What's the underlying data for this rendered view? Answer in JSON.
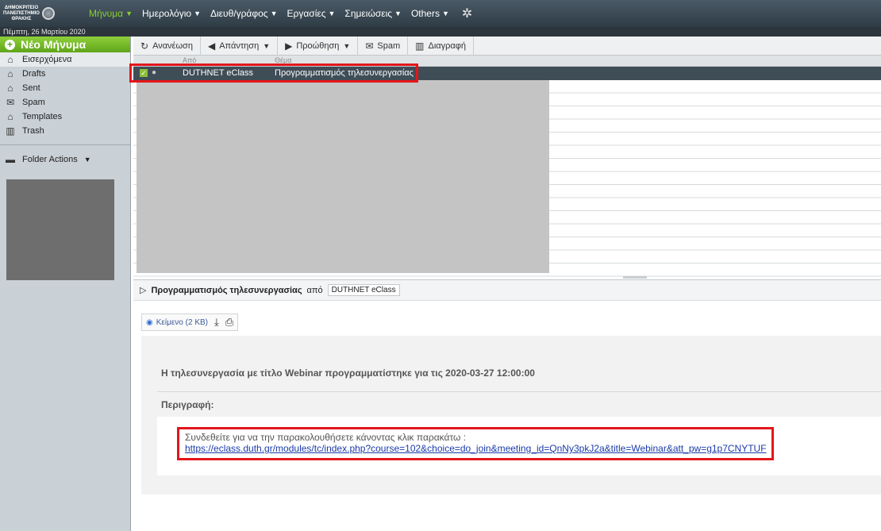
{
  "brand": {
    "logo_lines": [
      "ΔΗΜΟΚΡΙΤΕΙΟ",
      "ΠΑΝΕΠΙΣΤΗΜΙΟ",
      "ΘΡΑΚΗΣ"
    ]
  },
  "menu": [
    {
      "label": "Μήνυμα",
      "active": true
    },
    {
      "label": "Ημερολόγιο",
      "active": false
    },
    {
      "label": "Διευθ/γράφος",
      "active": false
    },
    {
      "label": "Εργασίες",
      "active": false
    },
    {
      "label": "Σημειώσεις",
      "active": false
    },
    {
      "label": "Others",
      "active": false
    }
  ],
  "date": "Πέμπτη, 26 Μαρτίου 2020",
  "sidebar": {
    "new_message": "Νέο Μήνυμα",
    "folders": [
      {
        "label": "Εισερχόμενα",
        "icon": "inbox-icon",
        "selected": true
      },
      {
        "label": "Drafts",
        "icon": "drafts-icon",
        "selected": false
      },
      {
        "label": "Sent",
        "icon": "sent-icon",
        "selected": false
      },
      {
        "label": "Spam",
        "icon": "spam-icon",
        "selected": false
      },
      {
        "label": "Templates",
        "icon": "templates-icon",
        "selected": false
      },
      {
        "label": "Trash",
        "icon": "trash-icon",
        "selected": false
      }
    ],
    "folder_actions": "Folder Actions"
  },
  "toolbar": {
    "refresh": "Ανανέωση",
    "reply": "Απάντηση",
    "forward": "Προώθηση",
    "spam": "Spam",
    "delete": "Διαγραφή"
  },
  "list": {
    "col_from": "Από",
    "col_subject": "Θέμα",
    "selected_row": {
      "from": "DUTHNET eClass",
      "subject": "Προγραμματισμός τηλεσυνεργασίας"
    }
  },
  "preview": {
    "subject": "Προγραμματισμός τηλεσυνεργασίας",
    "from_word": "από",
    "sender": "DUTHNET eClass",
    "attachment": "Κείμενο (2 KB)",
    "title": "Η τηλεσυνεργασία με τίτλο Webinar προγραμματίστηκε για τις 2020-03-27 12:00:00",
    "description_label": "Περιγραφή:",
    "body_line": "Συνδεθείτε για να την παρακολουθήσετε κάνοντας κλικ παρακάτω :",
    "link": "https://eclass.duth.gr/modules/tc/index.php?course=102&choice=do_join&meeting_id=QnNy3pkJ2a&title=Webinar&att_pw=g1p7CNYTUF"
  },
  "colors": {
    "accent_green": "#8ccf2f",
    "highlight_red": "#e3161b",
    "topbar": "#2f3c46"
  }
}
